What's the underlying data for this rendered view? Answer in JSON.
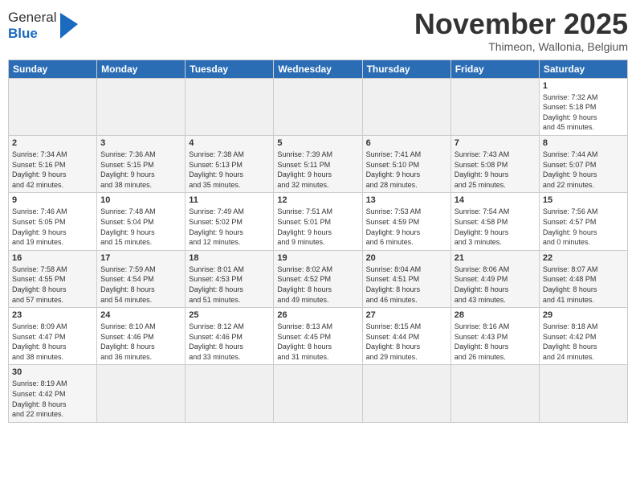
{
  "logo": {
    "line1": "General",
    "line2": "Blue"
  },
  "title": "November 2025",
  "subtitle": "Thimeon, Wallonia, Belgium",
  "days_of_week": [
    "Sunday",
    "Monday",
    "Tuesday",
    "Wednesday",
    "Thursday",
    "Friday",
    "Saturday"
  ],
  "weeks": [
    [
      {
        "day": "",
        "info": ""
      },
      {
        "day": "",
        "info": ""
      },
      {
        "day": "",
        "info": ""
      },
      {
        "day": "",
        "info": ""
      },
      {
        "day": "",
        "info": ""
      },
      {
        "day": "",
        "info": ""
      },
      {
        "day": "1",
        "info": "Sunrise: 7:32 AM\nSunset: 5:18 PM\nDaylight: 9 hours\nand 45 minutes."
      }
    ],
    [
      {
        "day": "2",
        "info": "Sunrise: 7:34 AM\nSunset: 5:16 PM\nDaylight: 9 hours\nand 42 minutes."
      },
      {
        "day": "3",
        "info": "Sunrise: 7:36 AM\nSunset: 5:15 PM\nDaylight: 9 hours\nand 38 minutes."
      },
      {
        "day": "4",
        "info": "Sunrise: 7:38 AM\nSunset: 5:13 PM\nDaylight: 9 hours\nand 35 minutes."
      },
      {
        "day": "5",
        "info": "Sunrise: 7:39 AM\nSunset: 5:11 PM\nDaylight: 9 hours\nand 32 minutes."
      },
      {
        "day": "6",
        "info": "Sunrise: 7:41 AM\nSunset: 5:10 PM\nDaylight: 9 hours\nand 28 minutes."
      },
      {
        "day": "7",
        "info": "Sunrise: 7:43 AM\nSunset: 5:08 PM\nDaylight: 9 hours\nand 25 minutes."
      },
      {
        "day": "8",
        "info": "Sunrise: 7:44 AM\nSunset: 5:07 PM\nDaylight: 9 hours\nand 22 minutes."
      }
    ],
    [
      {
        "day": "9",
        "info": "Sunrise: 7:46 AM\nSunset: 5:05 PM\nDaylight: 9 hours\nand 19 minutes."
      },
      {
        "day": "10",
        "info": "Sunrise: 7:48 AM\nSunset: 5:04 PM\nDaylight: 9 hours\nand 15 minutes."
      },
      {
        "day": "11",
        "info": "Sunrise: 7:49 AM\nSunset: 5:02 PM\nDaylight: 9 hours\nand 12 minutes."
      },
      {
        "day": "12",
        "info": "Sunrise: 7:51 AM\nSunset: 5:01 PM\nDaylight: 9 hours\nand 9 minutes."
      },
      {
        "day": "13",
        "info": "Sunrise: 7:53 AM\nSunset: 4:59 PM\nDaylight: 9 hours\nand 6 minutes."
      },
      {
        "day": "14",
        "info": "Sunrise: 7:54 AM\nSunset: 4:58 PM\nDaylight: 9 hours\nand 3 minutes."
      },
      {
        "day": "15",
        "info": "Sunrise: 7:56 AM\nSunset: 4:57 PM\nDaylight: 9 hours\nand 0 minutes."
      }
    ],
    [
      {
        "day": "16",
        "info": "Sunrise: 7:58 AM\nSunset: 4:55 PM\nDaylight: 8 hours\nand 57 minutes."
      },
      {
        "day": "17",
        "info": "Sunrise: 7:59 AM\nSunset: 4:54 PM\nDaylight: 8 hours\nand 54 minutes."
      },
      {
        "day": "18",
        "info": "Sunrise: 8:01 AM\nSunset: 4:53 PM\nDaylight: 8 hours\nand 51 minutes."
      },
      {
        "day": "19",
        "info": "Sunrise: 8:02 AM\nSunset: 4:52 PM\nDaylight: 8 hours\nand 49 minutes."
      },
      {
        "day": "20",
        "info": "Sunrise: 8:04 AM\nSunset: 4:51 PM\nDaylight: 8 hours\nand 46 minutes."
      },
      {
        "day": "21",
        "info": "Sunrise: 8:06 AM\nSunset: 4:49 PM\nDaylight: 8 hours\nand 43 minutes."
      },
      {
        "day": "22",
        "info": "Sunrise: 8:07 AM\nSunset: 4:48 PM\nDaylight: 8 hours\nand 41 minutes."
      }
    ],
    [
      {
        "day": "23",
        "info": "Sunrise: 8:09 AM\nSunset: 4:47 PM\nDaylight: 8 hours\nand 38 minutes."
      },
      {
        "day": "24",
        "info": "Sunrise: 8:10 AM\nSunset: 4:46 PM\nDaylight: 8 hours\nand 36 minutes."
      },
      {
        "day": "25",
        "info": "Sunrise: 8:12 AM\nSunset: 4:46 PM\nDaylight: 8 hours\nand 33 minutes."
      },
      {
        "day": "26",
        "info": "Sunrise: 8:13 AM\nSunset: 4:45 PM\nDaylight: 8 hours\nand 31 minutes."
      },
      {
        "day": "27",
        "info": "Sunrise: 8:15 AM\nSunset: 4:44 PM\nDaylight: 8 hours\nand 29 minutes."
      },
      {
        "day": "28",
        "info": "Sunrise: 8:16 AM\nSunset: 4:43 PM\nDaylight: 8 hours\nand 26 minutes."
      },
      {
        "day": "29",
        "info": "Sunrise: 8:18 AM\nSunset: 4:42 PM\nDaylight: 8 hours\nand 24 minutes."
      }
    ],
    [
      {
        "day": "30",
        "info": "Sunrise: 8:19 AM\nSunset: 4:42 PM\nDaylight: 8 hours\nand 22 minutes."
      },
      {
        "day": "",
        "info": ""
      },
      {
        "day": "",
        "info": ""
      },
      {
        "day": "",
        "info": ""
      },
      {
        "day": "",
        "info": ""
      },
      {
        "day": "",
        "info": ""
      },
      {
        "day": "",
        "info": ""
      }
    ]
  ]
}
